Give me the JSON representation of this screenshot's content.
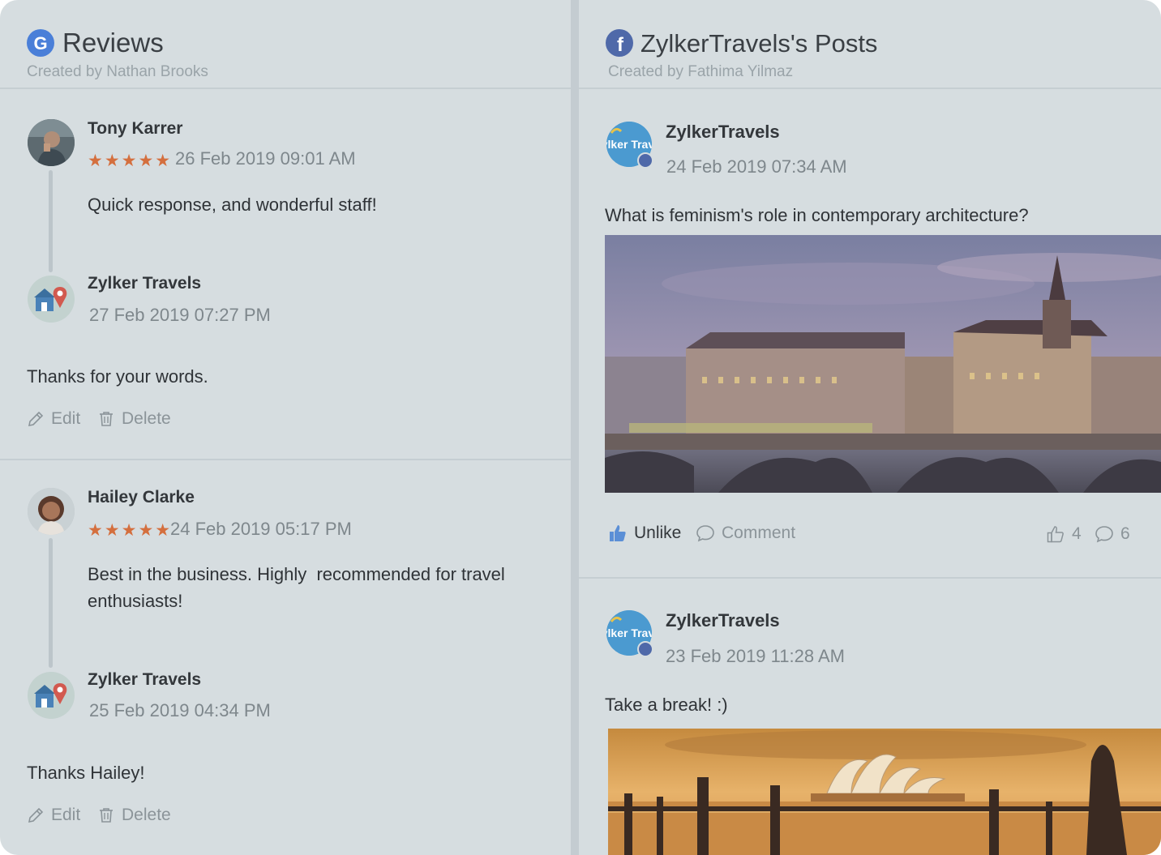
{
  "reviews_panel": {
    "title": "Reviews",
    "subtitle": "Created by Nathan Brooks",
    "icon": "google-g-icon",
    "threads": [
      {
        "reviewer": "Tony Karrer",
        "stars": "★★★★★",
        "rating": 5,
        "date": "26 Feb 2019 09:01 AM",
        "text": "Quick response, and wonderful staff!",
        "reply": {
          "author": "Zylker Travels",
          "date": "27 Feb 2019 07:27 PM",
          "text": "Thanks for your words."
        },
        "actions": {
          "edit": "Edit",
          "delete": "Delete"
        }
      },
      {
        "reviewer": "Hailey Clarke",
        "stars": "★★★★★",
        "rating": 5,
        "date": "24 Feb 2019 05:17 PM",
        "text_line1": "Best in the business. Highly  recommended for travel",
        "text_line2": "enthusiasts!",
        "reply": {
          "author": "Zylker Travels",
          "date": "25 Feb 2019 04:34 PM",
          "text": "Thanks Hailey!"
        },
        "actions": {
          "edit": "Edit",
          "delete": "Delete"
        }
      }
    ]
  },
  "posts_panel": {
    "title": "ZylkerTravels's Posts",
    "subtitle": "Created by Fathima Yilmaz",
    "icon": "facebook-icon",
    "posts": [
      {
        "author": "ZylkerTravels",
        "avatar_text": "Zylker Travel",
        "date": "24 Feb 2019 07:34 AM",
        "text": "What is feminism's role in contemporary architecture?",
        "image": "city-bridge-dusk-photo",
        "like_label": "Unlike",
        "comment_label": "Comment",
        "like_count": "4",
        "comment_count": "6"
      },
      {
        "author": "ZylkerTravels",
        "avatar_text": "Zylker Travel",
        "date": "23 Feb 2019 11:28 AM",
        "text": "Take a break! :)",
        "image": "sydney-opera-house-sunset-photo"
      }
    ]
  },
  "colors": {
    "background": "#d6dde0",
    "star": "#d46f3e",
    "like_blue": "#5b8fd6",
    "google_blue": "#4a7fd8",
    "facebook_blue": "#4f69a9"
  }
}
